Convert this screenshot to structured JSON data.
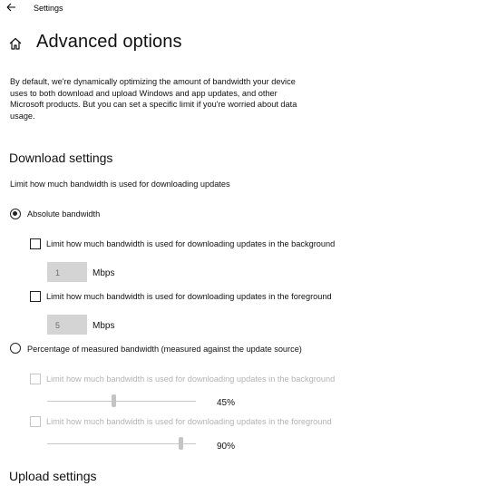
{
  "titlebar": {
    "title": "Settings",
    "back_icon": "arrow-left-icon"
  },
  "header": {
    "home_icon": "home-icon",
    "title": "Advanced options"
  },
  "description": "By default, we're dynamically optimizing the amount of bandwidth your device uses to both download and upload Windows and app updates, and other Microsoft products. But you can set a specific limit if you're worried about data usage.",
  "download": {
    "section_title": "Download settings",
    "subtitle": "Limit how much bandwidth is used for downloading updates",
    "absolute": {
      "label": "Absolute bandwidth",
      "selected": true,
      "background_label": "Limit how much bandwidth is used for downloading updates in the background",
      "background_checked": false,
      "background_value": "1",
      "background_unit": "Mbps",
      "foreground_label": "Limit how much bandwidth is used for downloading updates in the foreground",
      "foreground_checked": false,
      "foreground_value": "5",
      "foreground_unit": "Mbps"
    },
    "percentage": {
      "label": "Percentage of measured bandwidth (measured against the update source)",
      "selected": false,
      "background_label": "Limit how much bandwidth is used for downloading updates in the background",
      "background_checked": false,
      "background_percent": 45,
      "background_percent_label": "45%",
      "foreground_label": "Limit how much bandwidth is used for downloading updates in the foreground",
      "foreground_checked": false,
      "foreground_percent": 90,
      "foreground_percent_label": "90%"
    }
  },
  "upload": {
    "section_title": "Upload settings"
  },
  "colors": {
    "text": "#111111",
    "disabled_text": "#b3b3b3",
    "input_bg": "#d4d4d4"
  }
}
